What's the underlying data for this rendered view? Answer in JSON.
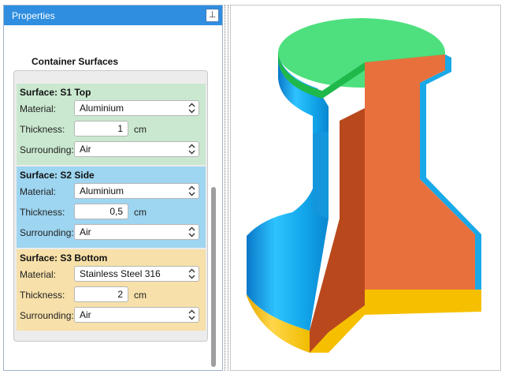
{
  "panel": {
    "title": "Properties",
    "pin_icon": "pin-icon",
    "pin_glyph": "⊥"
  },
  "section_heading": "Container Surfaces",
  "labels": {
    "material": "Material:",
    "thickness": "Thickness:",
    "surrounding": "Surrounding:",
    "unit": "cm"
  },
  "surfaces": [
    {
      "title": "Surface: S1 Top",
      "material": "Aluminium",
      "thickness": "1",
      "surrounding": "Air",
      "color": "#c9e8cf"
    },
    {
      "title": "Surface: S2 Side",
      "material": "Aluminium",
      "thickness": "0,5",
      "surrounding": "Air",
      "color": "#9ed5f1"
    },
    {
      "title": "Surface: S3 Bottom",
      "material": "Stainless Steel 316",
      "thickness": "2",
      "surrounding": "Air",
      "color": "#f7e0a9"
    }
  ],
  "colors": {
    "header_blue": "#2f8ee0",
    "top_green": "#4ee07e",
    "rim_green": "#1fb84b",
    "side_blue": "#1aa9e8",
    "cut_orange": "#e8703d",
    "cut_dark": "#b9491d",
    "bottom_yellow": "#f6c000"
  }
}
